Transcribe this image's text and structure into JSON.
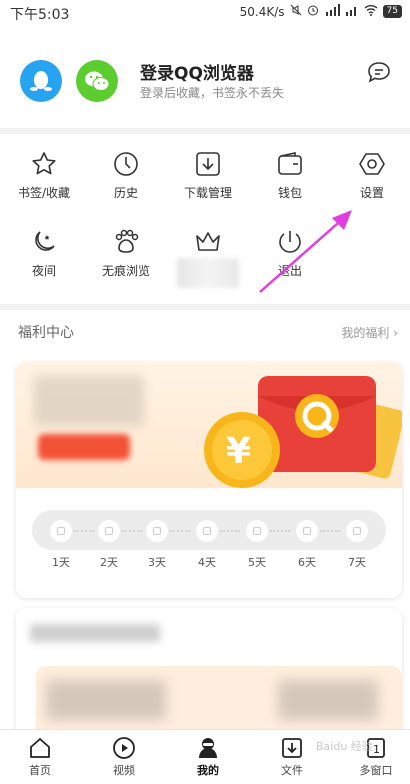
{
  "status_bar": {
    "time": "下午5:03",
    "speed": "50.4K/s",
    "battery": "75"
  },
  "header": {
    "login_title": "登录QQ浏览器",
    "login_subtitle": "登录后收藏，书签永不丢失"
  },
  "grid": {
    "items": [
      {
        "label": "书签/收藏",
        "icon": "star-icon"
      },
      {
        "label": "历史",
        "icon": "clock-icon"
      },
      {
        "label": "下载管理",
        "icon": "download-icon"
      },
      {
        "label": "钱包",
        "icon": "wallet-icon"
      },
      {
        "label": "设置",
        "icon": "gear-hexagon-icon"
      },
      {
        "label": "夜间",
        "icon": "moon-icon"
      },
      {
        "label": "无痕浏览",
        "icon": "paw-icon"
      },
      {
        "label": "",
        "icon": "crown-icon"
      },
      {
        "label": "退出",
        "icon": "power-icon"
      }
    ]
  },
  "welfare": {
    "title": "福利中心",
    "link": "我的福利 ›",
    "days": [
      "1天",
      "2天",
      "3天",
      "4天",
      "5天",
      "6天",
      "7天"
    ]
  },
  "bottom_nav": {
    "items": [
      {
        "label": "首页",
        "icon": "home-icon"
      },
      {
        "label": "视频",
        "icon": "video-play-icon"
      },
      {
        "label": "我的",
        "icon": "profile-icon"
      },
      {
        "label": "文件",
        "icon": "file-download-icon"
      },
      {
        "label": "多窗口",
        "icon": "multi-window-icon"
      }
    ]
  },
  "colors": {
    "qq_blue": "#27a3f0",
    "wechat_green": "#5ccd2e",
    "red_packet": "#e8413a",
    "coin_gold": "#f8b61a",
    "arrow_magenta": "#e23de3"
  },
  "watermark": "Baidu 经验"
}
